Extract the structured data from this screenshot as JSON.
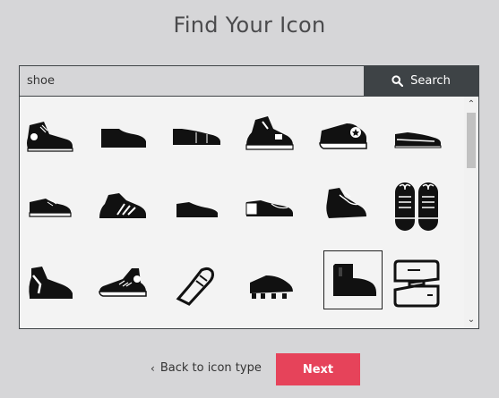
{
  "page": {
    "title": "Find Your Icon"
  },
  "search": {
    "value": "shoe",
    "button_label": "Search"
  },
  "results": {
    "icons": [
      {
        "name": "high-top-sneaker-icon"
      },
      {
        "name": "dress-shoe-icon"
      },
      {
        "name": "slip-on-icon"
      },
      {
        "name": "basketball-sneaker-icon"
      },
      {
        "name": "star-sneaker-icon"
      },
      {
        "name": "loafer-icon"
      },
      {
        "name": "low-sneaker-icon"
      },
      {
        "name": "striped-sneaker-icon"
      },
      {
        "name": "oxford-shoe-icon"
      },
      {
        "name": "wingtip-shoe-icon"
      },
      {
        "name": "laced-sneaker-icon"
      },
      {
        "name": "shoe-pair-icon"
      },
      {
        "name": "high-top-trainer-icon"
      },
      {
        "name": "converse-sneaker-icon"
      },
      {
        "name": "outline-shoe-icon"
      },
      {
        "name": "cleat-shoe-icon"
      },
      {
        "name": "boot-icon",
        "selected": true
      },
      {
        "name": "shoe-box-icon"
      }
    ]
  },
  "footer": {
    "back_label": "Back to icon type",
    "next_label": "Next"
  }
}
